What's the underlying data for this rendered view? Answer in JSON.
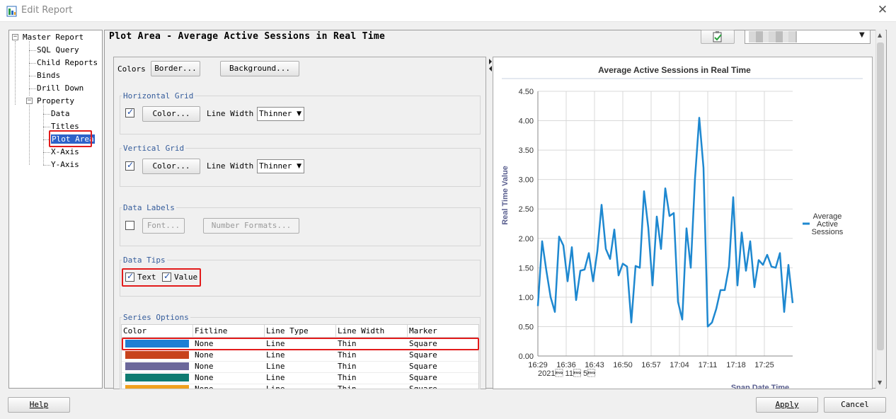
{
  "window": {
    "title": "Edit Report"
  },
  "tree": {
    "root": "Master Report",
    "items": [
      "SQL Query",
      "Child Reports",
      "Binds",
      "Drill Down",
      "Property"
    ],
    "property_children": [
      "Data",
      "Titles",
      "Plot Area",
      "X-Axis",
      "Y-Axis"
    ],
    "selected": "Plot Area"
  },
  "panel": {
    "title": "Plot Area - Average Active Sessions in Real Time"
  },
  "colors": {
    "label": "Colors",
    "border_btn": "Border...",
    "background_btn": "Background..."
  },
  "horizontal_grid": {
    "label": "Horizontal Grid",
    "checked": true,
    "color_btn": "Color...",
    "line_width_label": "Line Width",
    "line_width": "Thinner"
  },
  "vertical_grid": {
    "label": "Vertical Grid",
    "checked": true,
    "color_btn": "Color...",
    "line_width_label": "Line Width",
    "line_width": "Thinner"
  },
  "data_labels": {
    "label": "Data Labels",
    "checked": false,
    "font_btn": "Font...",
    "number_formats_btn": "Number Formats..."
  },
  "data_tips": {
    "label": "Data Tips",
    "text_label": "Text",
    "text_checked": true,
    "value_label": "Value",
    "value_checked": true
  },
  "series_options": {
    "label": "Series Options",
    "headers": [
      "Color",
      "Fitline",
      "Line Type",
      "Line Width",
      "Marker"
    ],
    "rows": [
      {
        "color": "#1e7fd4",
        "fitline": "None",
        "line_type": "Line",
        "line_width": "Thin",
        "marker": "Square"
      },
      {
        "color": "#c8421c",
        "fitline": "None",
        "line_type": "Line",
        "line_width": "Thin",
        "marker": "Square"
      },
      {
        "color": "#6b679a",
        "fitline": "None",
        "line_type": "Line",
        "line_width": "Thin",
        "marker": "Square"
      },
      {
        "color": "#0f7b71",
        "fitline": "None",
        "line_type": "Line",
        "line_width": "Thin",
        "marker": "Square"
      },
      {
        "color": "#f0a01e",
        "fitline": "None",
        "line_type": "Line",
        "line_width": "Thin",
        "marker": "Square"
      }
    ]
  },
  "chart_data": {
    "type": "line",
    "title": "Average Active Sessions in Real Time",
    "ylabel": "Real Time Value",
    "xlabel": "Snap Date Time",
    "date_label": "2021\u0005 11\u0005 5\u0005",
    "ylim": [
      0,
      4.5
    ],
    "yticks": [
      "0.00",
      "0.50",
      "1.00",
      "1.50",
      "2.00",
      "2.50",
      "3.00",
      "3.50",
      "4.00",
      "4.50"
    ],
    "xticks": [
      "16:29",
      "16:36",
      "16:43",
      "16:50",
      "16:57",
      "17:04",
      "17:11",
      "17:18",
      "17:25"
    ],
    "grid": true,
    "legend_position": "right",
    "series": [
      {
        "name": "Average Active Sessions",
        "color": "#1e88d0",
        "values": [
          0.85,
          1.95,
          1.45,
          1.0,
          0.75,
          2.03,
          1.88,
          1.27,
          1.85,
          0.95,
          1.45,
          1.47,
          1.75,
          1.27,
          1.78,
          2.57,
          1.82,
          1.65,
          2.15,
          1.37,
          1.57,
          1.52,
          0.57,
          1.53,
          1.5,
          2.8,
          2.18,
          1.2,
          2.37,
          1.82,
          2.85,
          2.38,
          2.43,
          0.92,
          0.62,
          2.17,
          1.5,
          3.02,
          4.05,
          3.2,
          0.5,
          0.57,
          0.8,
          1.12,
          1.12,
          1.52,
          2.7,
          1.2,
          2.1,
          1.45,
          1.95,
          1.17,
          1.63,
          1.55,
          1.72,
          1.52,
          1.5,
          1.75,
          0.75,
          1.55,
          0.9
        ]
      }
    ]
  },
  "buttons": {
    "help": "Help",
    "apply": "Apply",
    "cancel": "Cancel"
  }
}
